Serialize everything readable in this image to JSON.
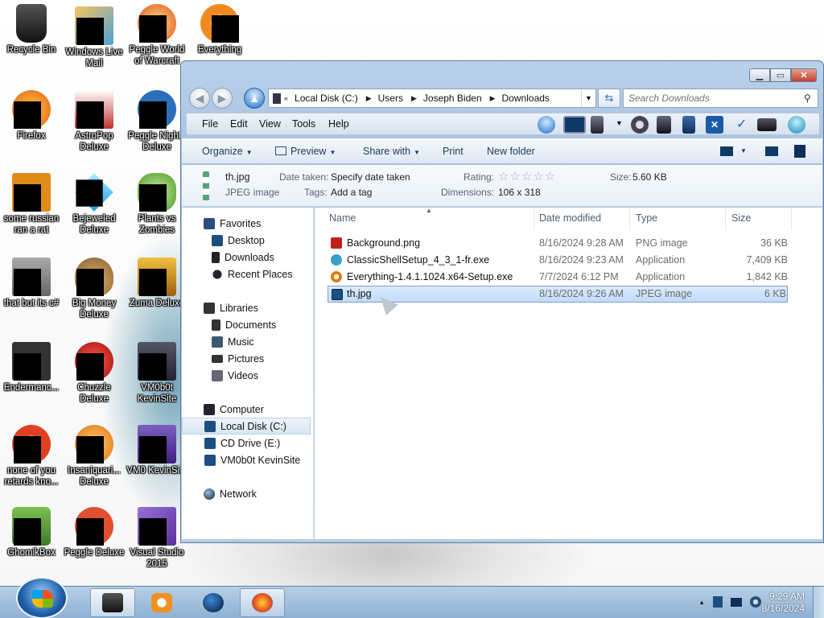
{
  "desktop": {
    "icons": [
      {
        "label": "Recycle Bin",
        "color": "#222"
      },
      {
        "label": "Windows Live Mail",
        "color": "#e0a040"
      },
      {
        "label": "Peggle World of Warcraft",
        "color": "#e05020"
      },
      {
        "label": "Everything",
        "color": "#f08a20"
      },
      {
        "label": "Firefox",
        "color": "#e55b1b"
      },
      {
        "label": "AstroPop Deluxe",
        "color": "#c03030"
      },
      {
        "label": "Peggle Nights Deluxe",
        "color": "#2b6fb8"
      },
      {
        "label": "some russian ran a rat",
        "color": "#e08b1a"
      },
      {
        "label": "Bejeweled Deluxe",
        "color": "#1aa0e0"
      },
      {
        "label": "Plants vs Zombies",
        "color": "#4c9a2a"
      },
      {
        "label": "that but its c#",
        "color": "#888"
      },
      {
        "label": "Big Money Deluxe",
        "color": "#a07a40"
      },
      {
        "label": "Zuma Deluxe",
        "color": "#d0a020"
      },
      {
        "label": "Endermanc...",
        "color": "#333"
      },
      {
        "label": "Chuzzle Deluxe",
        "color": "#c02020"
      },
      {
        "label": "VM0b0t KevinSite",
        "color": "#445"
      },
      {
        "label": "none of you retards kno...",
        "color": "#e04020"
      },
      {
        "label": "Insaniquari... Deluxe",
        "color": "#f0a030"
      },
      {
        "label": "VM0 KevinSi...",
        "color": "#5040a0"
      },
      {
        "label": "GhomikBox",
        "color": "#5aa040"
      },
      {
        "label": "Peggle Deluxe",
        "color": "#e05030"
      },
      {
        "label": "Visual Studio 2015",
        "color": "#6a3fa0"
      }
    ]
  },
  "window": {
    "address": {
      "crumbs": [
        "Local Disk (C:)",
        "Users",
        "Joseph Biden",
        "Downloads"
      ]
    },
    "search_placeholder": "Search Downloads",
    "menu": [
      "File",
      "Edit",
      "View",
      "Tools",
      "Help"
    ],
    "commands": {
      "organize": "Organize",
      "preview": "Preview",
      "share": "Share with",
      "print": "Print",
      "new_folder": "New folder"
    },
    "details": {
      "name": "th.jpg",
      "type": "JPEG image",
      "date_taken_label": "Date taken:",
      "date_taken_value": "Specify date taken",
      "tags_label": "Tags:",
      "tags_value": "Add a tag",
      "rating_label": "Rating:",
      "rating_stars": "☆☆☆☆☆",
      "dimensions_label": "Dimensions:",
      "dimensions_value": "106 x 318",
      "size_label": "Size:",
      "size_value": "5.60 KB"
    },
    "nav": {
      "favorites": "Favorites",
      "desktop": "Desktop",
      "downloads": "Downloads",
      "recent": "Recent Places",
      "libraries": "Libraries",
      "documents": "Documents",
      "music": "Music",
      "pictures": "Pictures",
      "videos": "Videos",
      "computer": "Computer",
      "local_disk": "Local Disk (C:)",
      "cd_drive": "CD Drive (E:)",
      "vm": "VM0b0t KevinSite",
      "network": "Network"
    },
    "columns": {
      "name": "Name",
      "date": "Date modified",
      "type": "Type",
      "size": "Size"
    },
    "files": [
      {
        "name": "Background.png",
        "date": "8/16/2024 9:28 AM",
        "type": "PNG image",
        "size": "36 KB",
        "color": "#c0201a"
      },
      {
        "name": "ClassicShellSetup_4_3_1-fr.exe",
        "date": "8/16/2024 9:23 AM",
        "type": "Application",
        "size": "7,409 KB",
        "color": "#3aa0c8"
      },
      {
        "name": "Everything-1.4.1.1024.x64-Setup.exe",
        "date": "7/7/2024 6:12 PM",
        "type": "Application",
        "size": "1,842 KB",
        "color": "#e07a10"
      },
      {
        "name": "th.jpg",
        "date": "8/16/2024 9:26 AM",
        "type": "JPEG image",
        "size": "6 KB",
        "color": "#1b4f80",
        "selected": true
      }
    ]
  },
  "taskbar": {
    "time": "9:29 AM",
    "date": "8/16/2024"
  }
}
